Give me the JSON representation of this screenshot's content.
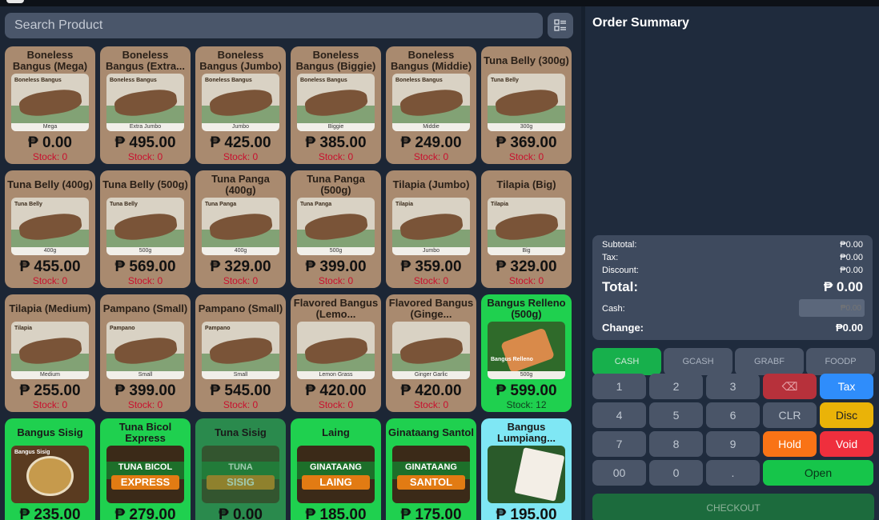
{
  "search": {
    "placeholder": "Search Product"
  },
  "products": [
    {
      "name": "Boneless Bangus (Mega)",
      "price": "₱ 0.00",
      "stock": "Stock: 0",
      "variant": "brown",
      "kind": "fish",
      "tag": "Boneless Bangus",
      "caption": "Mega"
    },
    {
      "name": "Boneless Bangus (Extra...",
      "price": "₱ 495.00",
      "stock": "Stock: 0",
      "variant": "brown",
      "kind": "fish",
      "tag": "Boneless Bangus",
      "caption": "Extra Jumbo"
    },
    {
      "name": "Boneless Bangus (Jumbo)",
      "price": "₱ 425.00",
      "stock": "Stock: 0",
      "variant": "brown",
      "kind": "fish",
      "tag": "Boneless Bangus",
      "caption": "Jumbo"
    },
    {
      "name": "Boneless Bangus (Biggie)",
      "price": "₱ 385.00",
      "stock": "Stock: 0",
      "variant": "brown",
      "kind": "fish",
      "tag": "Boneless Bangus",
      "caption": "Biggie"
    },
    {
      "name": "Boneless Bangus (Middie)",
      "price": "₱ 249.00",
      "stock": "Stock: 0",
      "variant": "brown",
      "kind": "fish",
      "tag": "Boneless Bangus",
      "caption": "Middie"
    },
    {
      "name": "Tuna Belly (300g)",
      "price": "₱ 369.00",
      "stock": "Stock: 0",
      "variant": "brown",
      "kind": "fish",
      "tag": "Tuna Belly",
      "caption": "300g"
    },
    {
      "name": "Tuna Belly (400g)",
      "price": "₱ 455.00",
      "stock": "Stock: 0",
      "variant": "brown",
      "kind": "fish",
      "tag": "Tuna Belly",
      "caption": "400g"
    },
    {
      "name": "Tuna Belly (500g)",
      "price": "₱ 569.00",
      "stock": "Stock: 0",
      "variant": "brown",
      "kind": "fish",
      "tag": "Tuna Belly",
      "caption": "500g"
    },
    {
      "name": "Tuna Panga (400g)",
      "price": "₱ 329.00",
      "stock": "Stock: 0",
      "variant": "brown",
      "kind": "fish",
      "tag": "Tuna Panga",
      "caption": "400g"
    },
    {
      "name": "Tuna Panga (500g)",
      "price": "₱ 399.00",
      "stock": "Stock: 0",
      "variant": "brown",
      "kind": "fish",
      "tag": "Tuna Panga",
      "caption": "500g"
    },
    {
      "name": "Tilapia (Jumbo)",
      "price": "₱ 359.00",
      "stock": "Stock: 0",
      "variant": "brown",
      "kind": "fish",
      "tag": "Tilapia",
      "caption": "Jumbo"
    },
    {
      "name": "Tilapia (Big)",
      "price": "₱ 329.00",
      "stock": "Stock: 0",
      "variant": "brown",
      "kind": "fish",
      "tag": "Tilapia",
      "caption": "Big"
    },
    {
      "name": "Tilapia (Medium)",
      "price": "₱ 255.00",
      "stock": "Stock: 0",
      "variant": "brown",
      "kind": "fish",
      "tag": "Tilapia",
      "caption": "Medium"
    },
    {
      "name": "Pampano (Small)",
      "price": "₱ 399.00",
      "stock": "Stock: 0",
      "variant": "brown",
      "kind": "fish",
      "tag": "Pampano",
      "caption": "Small"
    },
    {
      "name": "Pampano (Small)",
      "price": "₱ 545.00",
      "stock": "Stock: 0",
      "variant": "brown",
      "kind": "fish",
      "tag": "Pampano",
      "caption": "Small"
    },
    {
      "name": "Flavored Bangus (Lemo...",
      "price": "₱ 420.00",
      "stock": "Stock: 0",
      "variant": "brown",
      "kind": "fish",
      "tag": "",
      "caption": "Lemon Grass"
    },
    {
      "name": "Flavored Bangus (Ginge...",
      "price": "₱ 420.00",
      "stock": "Stock: 0",
      "variant": "brown",
      "kind": "fish",
      "tag": "",
      "caption": "Ginger Garlic"
    },
    {
      "name": "Bangus Relleno (500g)",
      "price": "₱ 599.00",
      "stock": "Stock: 12",
      "variant": "green",
      "kind": "roll",
      "tag": "Bangus Relleno",
      "caption": "500g"
    },
    {
      "name": "Bangus Sisig",
      "price": "₱ 235.00",
      "stock": "",
      "variant": "green",
      "kind": "dish",
      "tag": "Bangus Sisig",
      "caption": ""
    },
    {
      "name": "Tuna Bicol Express",
      "price": "₱ 279.00",
      "stock": "",
      "variant": "green",
      "kind": "banner",
      "tag": "TUNA BICOL",
      "caption": "EXPRESS"
    },
    {
      "name": "Tuna Sisig",
      "price": "₱ 0.00",
      "stock": "",
      "variant": "dkgreen",
      "kind": "banner",
      "tag": "TUNA",
      "caption": "SISIG"
    },
    {
      "name": "Laing",
      "price": "₱ 185.00",
      "stock": "",
      "variant": "green",
      "kind": "banner",
      "tag": "GINATAANG",
      "caption": "LAING"
    },
    {
      "name": "Ginataang Santol",
      "price": "₱ 175.00",
      "stock": "",
      "variant": "green",
      "kind": "banner",
      "tag": "GINATAANG",
      "caption": "SANTOL"
    },
    {
      "name": "Bangus Lumpiang...",
      "price": "₱ 195.00",
      "stock": "",
      "variant": "cyan",
      "kind": "pack",
      "tag": "",
      "caption": ""
    }
  ],
  "order_summary": {
    "title": "Order Summary",
    "subtotal_label": "Subtotal:",
    "subtotal": "₱0.00",
    "tax_label": "Tax:",
    "tax": "₱0.00",
    "discount_label": "Discount:",
    "discount": "₱0.00",
    "total_label": "Total:",
    "total": "₱ 0.00",
    "cash_label": "Cash:",
    "cash_placeholder": "₱0.00",
    "change_label": "Change:",
    "change": "₱0.00"
  },
  "payment_methods": [
    "CASH",
    "GCASH",
    "GRABF",
    "FOODP"
  ],
  "keypad": {
    "k1": "1",
    "k2": "2",
    "k3": "3",
    "k4": "4",
    "k5": "5",
    "k6": "6",
    "k7": "7",
    "k8": "8",
    "k9": "9",
    "k00": "00",
    "k0": "0",
    "kdot": ".",
    "backspace": "⌫",
    "tax": "Tax",
    "clr": "CLR",
    "disc": "Disc",
    "hold": "Hold",
    "void": "Void",
    "open": "Open"
  },
  "checkout_label": "CHECKOUT",
  "colors": {
    "card_out_of_stock": "#a98a6f",
    "card_available": "#1fd04f",
    "accent_pay": "#17b04c"
  }
}
